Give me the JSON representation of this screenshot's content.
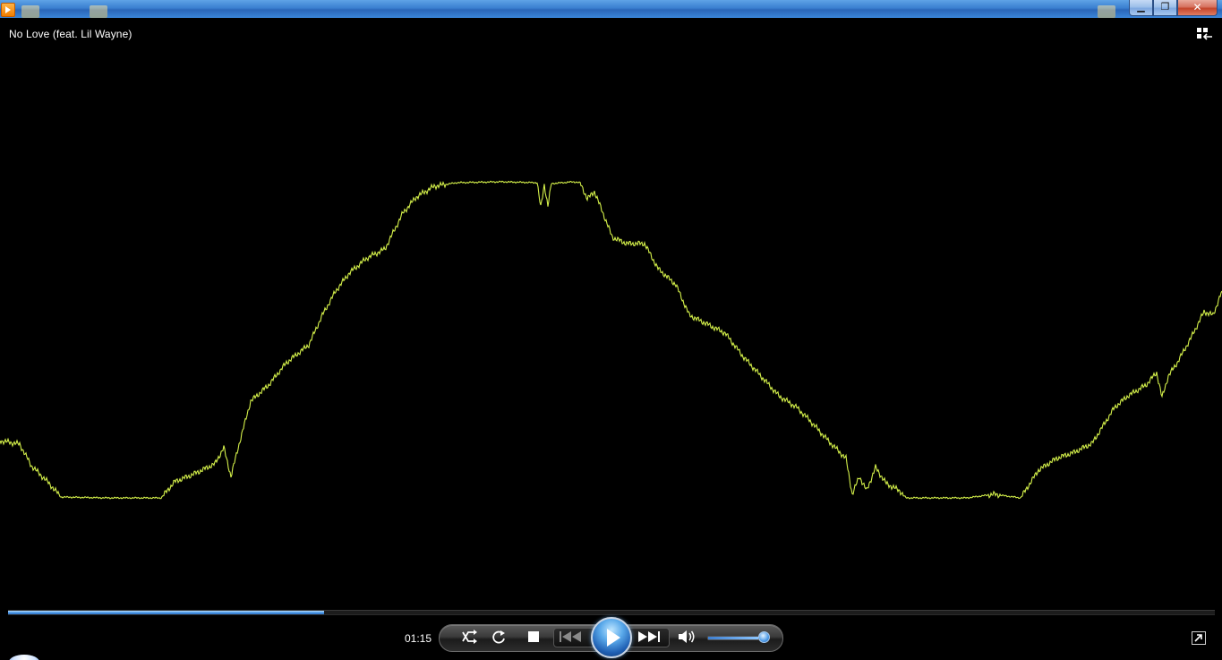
{
  "window": {
    "app_icon": "media-player-icon",
    "controls": {
      "minimize": "minimize-icon",
      "maximize": "restore-icon",
      "close": "close-icon"
    }
  },
  "now_playing": {
    "title": "No Love (feat. Lil Wayne)"
  },
  "playback": {
    "elapsed": "01:15",
    "progress_fraction": 0.262,
    "volume_fraction": 0.9,
    "state": "paused"
  },
  "controls": {
    "icons": [
      "shuffle-icon",
      "repeat-icon",
      "stop-icon",
      "previous-icon",
      "play-icon",
      "next-icon",
      "volume-icon"
    ],
    "accent": "#4c9be8"
  },
  "visualization": {
    "type": "waveform",
    "line_color": "#d4f04a",
    "background": "#000000"
  }
}
